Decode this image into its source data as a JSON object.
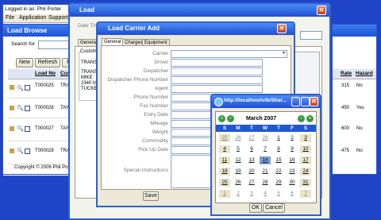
{
  "bg_app": {
    "user_line": "Logged in as: Phil Porter",
    "menu": [
      "File",
      "Application",
      "Support"
    ],
    "window_title": "Load Browse",
    "search_label": "Search for",
    "toolbar": {
      "new": "New",
      "refresh": "Refresh",
      "filter": "Fi"
    },
    "columns": [
      "Load No",
      "Cust"
    ],
    "rows": [
      {
        "load_no": "T000025",
        "cust": "TRAN"
      },
      {
        "load_no": "T000026",
        "cust": "TAYL"
      },
      {
        "load_no": "T000027",
        "cust": "TAYL"
      },
      {
        "load_no": "T000028",
        "cust": "TRAD"
      }
    ],
    "right_columns": [
      "Rate",
      "Hazard"
    ],
    "right_rows": [
      {
        "rate": "315",
        "hazard": "No"
      },
      {
        "rate": "450",
        "hazard": "Yes"
      },
      {
        "rate": "600",
        "hazard": "No"
      },
      {
        "rate": "475",
        "hazard": "No"
      }
    ],
    "copyright": "Copyright © 2006 Phil Porter"
  },
  "load_window": {
    "title": "Load",
    "date_time_label": "Date Tim",
    "general_tab": "General",
    "customer_label": "Custome",
    "customer_lines": [
      "TRANS C",
      "TRANS C",
      "MIKE",
      "2340 MIG",
      "TUCKER"
    ]
  },
  "carrier_add": {
    "title": "Load Carrier Add",
    "tabs": [
      "General",
      "Charges",
      "Equipment"
    ],
    "fields": [
      "Carrier",
      "Driver",
      "Dispatcher",
      "Dispatcher Phone Number",
      "Agent",
      "Phone Number",
      "Fax Number",
      "Entry Date",
      "Mileage",
      "Weight",
      "Commodity",
      "Pick Up Date",
      "Special Instructions"
    ],
    "save_label": "Save"
  },
  "calendar": {
    "url": "http://localhost/vlb/Shar...",
    "month_year": "March 2007",
    "weekdays": [
      "S",
      "M",
      "T",
      "W",
      "T",
      "F",
      "S"
    ],
    "weeks": [
      [
        "25",
        "26",
        "27",
        "28",
        "1",
        "2",
        "3"
      ],
      [
        "4",
        "5",
        "6",
        "7",
        "8",
        "9",
        "10"
      ],
      [
        "11",
        "12",
        "13",
        "14",
        "15",
        "16",
        "17"
      ],
      [
        "18",
        "19",
        "20",
        "21",
        "22",
        "23",
        "24"
      ],
      [
        "25",
        "26",
        "27",
        "28",
        "29",
        "30",
        "31"
      ],
      [
        "1",
        "2",
        "3",
        "4",
        "5",
        "6",
        "7"
      ]
    ],
    "ok": "OK",
    "cancel": "Cancel"
  }
}
